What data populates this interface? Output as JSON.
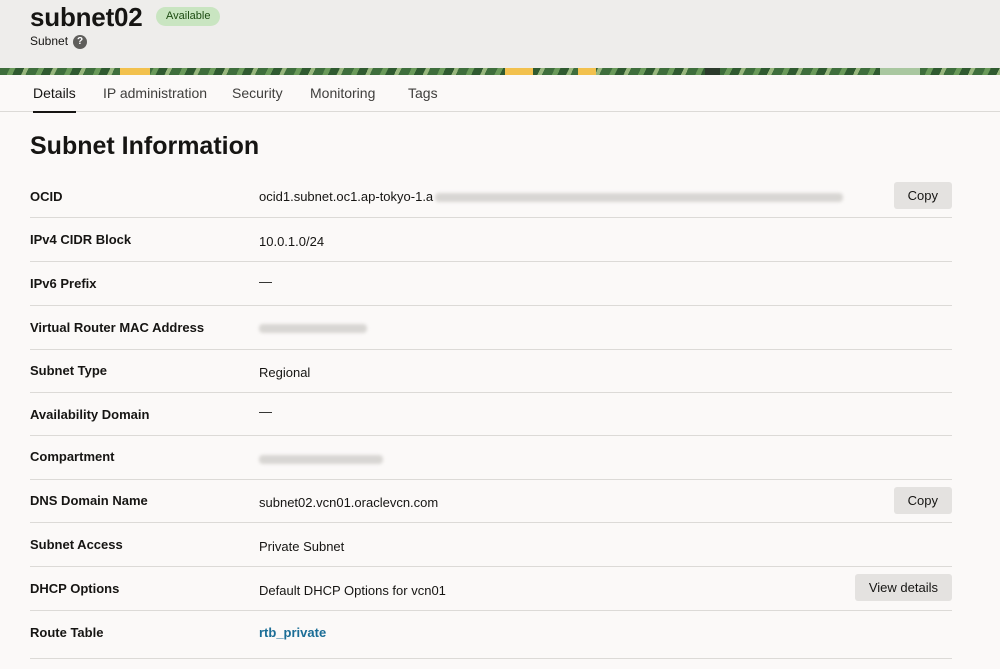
{
  "header": {
    "resource_name": "subnet02",
    "status": "Available",
    "resource_type": "Subnet",
    "help": "?"
  },
  "tabs": [
    {
      "label": "Details"
    },
    {
      "label": "IP administration"
    },
    {
      "label": "Security"
    },
    {
      "label": "Monitoring"
    },
    {
      "label": "Tags"
    }
  ],
  "section": {
    "title": "Subnet Information",
    "rows": [
      {
        "label": "OCID",
        "value": "ocid1.subnet.oc1.ap-tokyo-1.a",
        "action": "Copy"
      },
      {
        "label": "IPv4 CIDR Block",
        "value": "10.0.1.0/24"
      },
      {
        "label": "IPv6 Prefix",
        "value": "—"
      },
      {
        "label": "Virtual Router MAC Address",
        "value": ""
      },
      {
        "label": "Subnet Type",
        "value": "Regional"
      },
      {
        "label": "Availability Domain",
        "value": "—"
      },
      {
        "label": "Compartment",
        "value": ""
      },
      {
        "label": "DNS Domain Name",
        "value": "subnet02.vcn01.oraclevcn.com",
        "action": "Copy"
      },
      {
        "label": "Subnet Access",
        "value": "Private Subnet"
      },
      {
        "label": "DHCP Options",
        "value": "Default DHCP Options for vcn01",
        "action": "View details"
      },
      {
        "label": "Route Table",
        "value": "rtb_private"
      }
    ]
  },
  "colors": {
    "badge_bg": "#c9e5c1",
    "link": "#1b6d96",
    "header_bg": "#eeedeb"
  }
}
